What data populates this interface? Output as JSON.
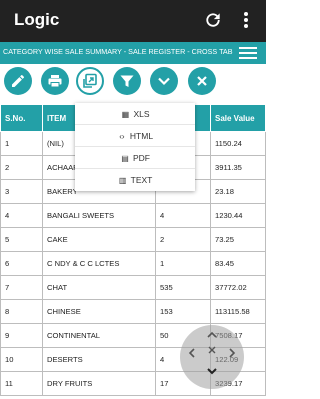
{
  "app": {
    "title": "Logic"
  },
  "header": {
    "subtitle": "CATEGORY WISE SALE SUMMARY - SALE REGISTER - CROSS TAB"
  },
  "toolbar": {
    "buttons": [
      "edit-icon",
      "print-icon",
      "export-icon",
      "filter-icon",
      "chevron-down-icon",
      "close-icon"
    ]
  },
  "export_menu": {
    "items": [
      {
        "label": "XLS",
        "icon": "xls-file-icon"
      },
      {
        "label": "HTML",
        "icon": "html-code-icon"
      },
      {
        "label": "PDF",
        "icon": "pdf-file-icon"
      },
      {
        "label": "TEXT",
        "icon": "text-file-icon"
      }
    ]
  },
  "table": {
    "columns": [
      "S.No.",
      "ITEM",
      "",
      "Sale Value"
    ],
    "rows": [
      [
        "1",
        "(NIL)",
        "",
        "1150.24"
      ],
      [
        "2",
        "ACHAAR",
        "",
        "3911.35"
      ],
      [
        "3",
        "BAKERY",
        "",
        "23.18"
      ],
      [
        "4",
        "BANGALI SWEETS",
        "4",
        "1230.44"
      ],
      [
        "5",
        "CAKE",
        "2",
        "73.25"
      ],
      [
        "6",
        "C NDY & C  C LCTES",
        "1",
        "83.45"
      ],
      [
        "7",
        "CHAT",
        "535",
        "37772.02"
      ],
      [
        "8",
        "CHINESE",
        "153",
        "113115.58"
      ],
      [
        "9",
        "CONTINENTAL",
        "50",
        "7508.17"
      ],
      [
        "10",
        "DESERTS",
        "4",
        "122.09"
      ],
      [
        "11",
        "DRY FRUITS",
        "17",
        "3239.17"
      ]
    ]
  },
  "colors": {
    "appbar": "#222222",
    "accent": "#23a0a7"
  }
}
